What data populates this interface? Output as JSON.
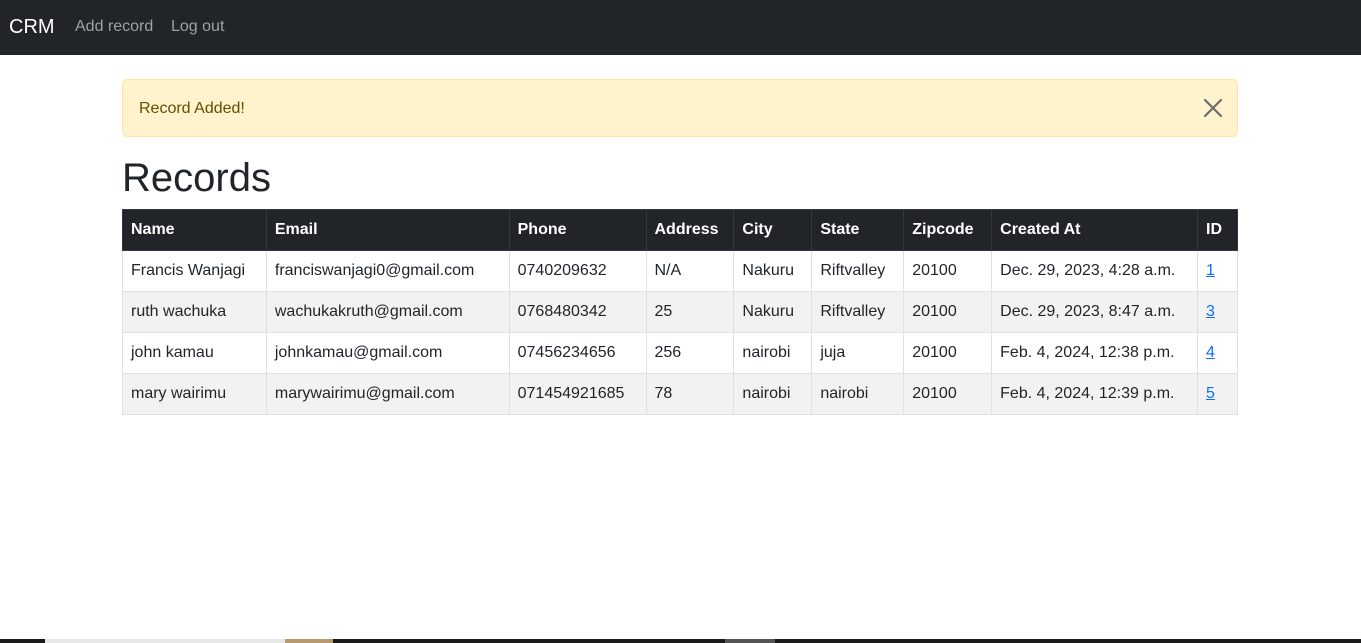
{
  "navbar": {
    "brand": "CRM",
    "links": [
      {
        "label": "Add record"
      },
      {
        "label": "Log out"
      }
    ]
  },
  "alert": {
    "message": "Record Added!",
    "close_icon": "close-icon"
  },
  "page": {
    "title": "Records"
  },
  "table": {
    "headers": [
      "Name",
      "Email",
      "Phone",
      "Address",
      "City",
      "State",
      "Zipcode",
      "Created At",
      "ID"
    ],
    "rows": [
      {
        "name": "Francis Wanjagi",
        "email": "franciswanjagi0@gmail.com",
        "phone": "0740209632",
        "address": "N/A",
        "city": "Nakuru",
        "state": "Riftvalley",
        "zipcode": "20100",
        "created_at": "Dec. 29, 2023, 4:28 a.m.",
        "id": "1"
      },
      {
        "name": "ruth wachuka",
        "email": "wachukakruth@gmail.com",
        "phone": "0768480342",
        "address": "25",
        "city": "Nakuru",
        "state": "Riftvalley",
        "zipcode": "20100",
        "created_at": "Dec. 29, 2023, 8:47 a.m.",
        "id": "3"
      },
      {
        "name": "john kamau",
        "email": "johnkamau@gmail.com",
        "phone": "07456234656",
        "address": "256",
        "city": "nairobi",
        "state": "juja",
        "zipcode": "20100",
        "created_at": "Feb. 4, 2024, 12:38 p.m.",
        "id": "4"
      },
      {
        "name": "mary wairimu",
        "email": "marywairimu@gmail.com",
        "phone": "071454921685",
        "address": "78",
        "city": "nairobi",
        "state": "nairobi",
        "zipcode": "20100",
        "created_at": "Feb. 4, 2024, 12:39 p.m.",
        "id": "5"
      }
    ]
  },
  "colors": {
    "navbar_bg": "#212529",
    "alert_bg": "#fff3cd",
    "alert_text": "#664d03",
    "link": "#0d6efd"
  }
}
